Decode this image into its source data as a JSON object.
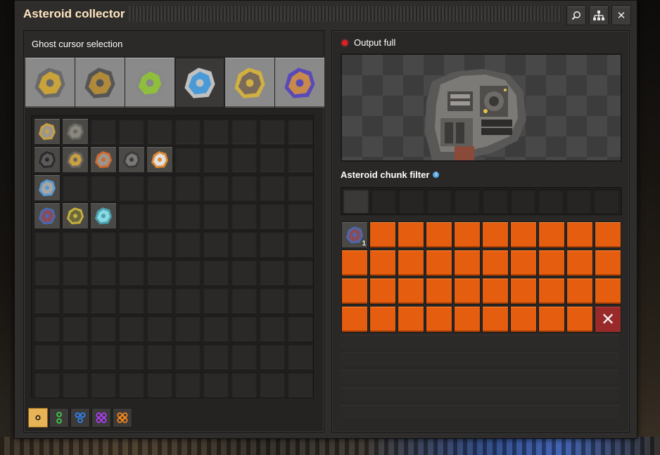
{
  "window": {
    "title": "Asteroid collector"
  },
  "titlebar": {
    "buttons": [
      {
        "name": "search-button",
        "icon": "magnifier-icon",
        "glyph": "⌕"
      },
      {
        "name": "tech-tree-button",
        "icon": "hierarchy-icon",
        "glyph": "⚏"
      },
      {
        "name": "close-button",
        "icon": "close-icon",
        "glyph": "✕"
      }
    ]
  },
  "left_panel": {
    "title": "Ghost cursor selection",
    "tabs": [
      {
        "icon": "logistics-icon",
        "active": false
      },
      {
        "icon": "production-icon",
        "active": false
      },
      {
        "icon": "intermediate-products-icon",
        "active": false
      },
      {
        "icon": "space-platform-icon",
        "active": true
      },
      {
        "icon": "combat-icon",
        "active": false
      },
      {
        "icon": "unsorted-icon",
        "active": false
      }
    ],
    "grid_rows": [
      [
        "asteroid-collector-icon",
        "crusher-icon",
        null,
        null,
        null,
        null,
        null,
        null,
        null,
        null
      ],
      [
        "space-platform-foundation-icon",
        "cargo-bay-icon",
        "thruster-icon",
        "space-platform-hub-icon",
        "rocket-icon",
        null,
        null,
        null,
        null,
        null
      ],
      [
        "space-platform-starter-pack-icon",
        null,
        null,
        null,
        null,
        null,
        null,
        null,
        null,
        null
      ],
      [
        "metallic-asteroid-chunk-icon",
        "carbonic-asteroid-chunk-icon",
        "oxide-asteroid-chunk-icon",
        null,
        null,
        null,
        null,
        null,
        null,
        null
      ],
      [
        null,
        null,
        null,
        null,
        null,
        null,
        null,
        null,
        null,
        null
      ],
      [
        null,
        null,
        null,
        null,
        null,
        null,
        null,
        null,
        null,
        null
      ],
      [
        null,
        null,
        null,
        null,
        null,
        null,
        null,
        null,
        null,
        null
      ],
      [
        null,
        null,
        null,
        null,
        null,
        null,
        null,
        null,
        null,
        null
      ],
      [
        null,
        null,
        null,
        null,
        null,
        null,
        null,
        null,
        null,
        null
      ],
      [
        null,
        null,
        null,
        null,
        null,
        null,
        null,
        null,
        null,
        null
      ]
    ],
    "quality_buttons": [
      {
        "name": "quality-normal",
        "color": "#1a1a1a",
        "dots": 1,
        "active": true
      },
      {
        "name": "quality-uncommon",
        "color": "#3fd64a",
        "dots": 2,
        "active": false
      },
      {
        "name": "quality-rare",
        "color": "#2f86ff",
        "dots": 3,
        "active": false
      },
      {
        "name": "quality-epic",
        "color": "#b43cff",
        "dots": 4,
        "active": false
      },
      {
        "name": "quality-legendary",
        "color": "#ff8a1a",
        "dots": 5,
        "active": false
      }
    ]
  },
  "right_panel": {
    "status_text": "Output full",
    "status_color": "#e02020",
    "preview_entity": "asteroid-collector-icon",
    "filter_label": "Asteroid chunk filter",
    "filter_slot_count": 10,
    "inventory": {
      "first_item_icon": "metallic-asteroid-chunk-icon",
      "first_item_count": "1",
      "orange_slots": 38,
      "close_glyph": "✕"
    }
  },
  "colors": {
    "locked_slot": "#e55e10",
    "title": "#ffe6c0",
    "active_quality": "#e8b356"
  }
}
